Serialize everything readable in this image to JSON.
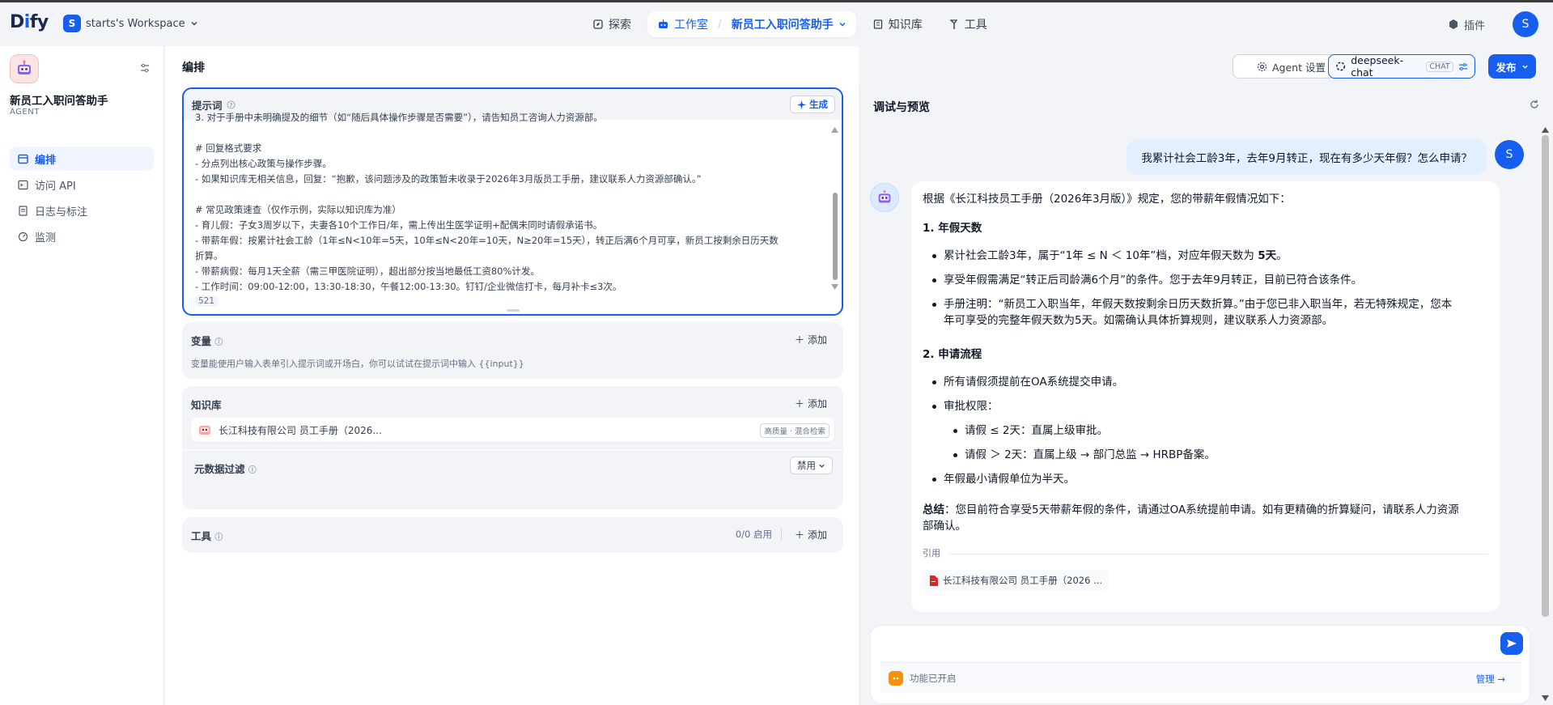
{
  "brand": {
    "logo_a": "D",
    "logo_b": "i",
    "logo_c": "fy"
  },
  "workspace": {
    "initial": "S",
    "name": "starts's Workspace"
  },
  "nav": {
    "explore": "探索",
    "studio": "工作室",
    "app_name": "新员工入职问答助手",
    "knowledge": "知识库",
    "tools": "工具",
    "plugins": "插件",
    "user_initial": "S"
  },
  "sidebar": {
    "app_name": "新员工入职问答助手",
    "app_type": "AGENT",
    "items": [
      {
        "label": "编排",
        "icon": "layout-icon",
        "active": true
      },
      {
        "label": "访问 API",
        "icon": "terminal-icon",
        "active": false
      },
      {
        "label": "日志与标注",
        "icon": "file-text-icon",
        "active": false
      },
      {
        "label": "监测",
        "icon": "monitor-icon",
        "active": false
      }
    ]
  },
  "editor": {
    "title": "编排",
    "agent_settings": "Agent 设置",
    "model_name": "deepseek-chat",
    "model_badge": "CHAT",
    "publish": "发布",
    "prompt": {
      "label": "提示词",
      "generate": "生成",
      "lines": [
        "3. 对于手册中未明确提及的细节（如“随后具体操作步骤是否需要”），请告知员工咨询人力资源部。",
        "",
        "# 回复格式要求",
        "- 分点列出核心政策与操作步骤。",
        "- 如果知识库无相关信息，回复：“抱歉，该问题涉及的政策暂未收录于2026年3月版员工手册，建议联系人力资源部确认。”",
        "",
        "# 常见政策速查（仅作示例，实际以知识库为准）",
        "- 育儿假：子女3周岁以下，夫妻各10个工作日/年，需上传出生医学证明+配偶未同时请假承诺书。",
        "- 带薪年假：按累计社会工龄（1年≤N<10年=5天，10年≤N<20年=10天，N≥20年=15天），转正后满6个月可享，新员工按剩余日历天数",
        "折算。",
        "- 带薪病假：每月1天全薪（需三甲医院证明），超出部分按当地最低工资80%计发。",
        "- 工作时间：09:00-12:00，13:30-18:30，午餐12:00-13:30。钉钉/企业微信打卡，每月补卡≤3次。"
      ],
      "char_count": "521"
    },
    "variables": {
      "label": "变量",
      "add": "添加",
      "hint": "变量能使用户输入表单引入提示词或开场白，你可以试试在提示词中输入 {{input}}"
    },
    "knowledge": {
      "label": "知识库",
      "add": "添加",
      "doc": "长江科技有限公司 员工手册（2026...",
      "tag": "高质量 · 混合检索"
    },
    "metadata": {
      "label": "元数据过滤",
      "value": "禁用"
    },
    "tools": {
      "label": "工具",
      "count": "0/0 启用",
      "add": "添加"
    }
  },
  "debug": {
    "title": "调试与预览",
    "user_initial": "S",
    "user_message": "我累计社会工龄3年，去年9月转正，现在有多少天年假？怎么申请？",
    "answer": {
      "intro": "根据《长江科技员工手册（2026年3月版）》规定，您的带薪年假情况如下：",
      "h1": "1. 年假天数",
      "b1_pre": "累计社会工龄3年，属于“1年 ≤ N ＜ 10年”档，对应年假天数为 ",
      "b1_bold": "5天",
      "b1_post": "。",
      "b2": "享受年假需满足“转正后司龄满6个月”的条件。您于去年9月转正，目前已符合该条件。",
      "b3a": "手册注明：“新员工入职当年，年假天数按剩余日历天数折算。”由于您已非入职当年，若无特殊规定，您本",
      "b3b": "年可享受的完整年假天数为5天。如需确认具体折算规则，建议联系人力资源部。",
      "h2": "2. 申请流程",
      "c1": "所有请假须提前在OA系统提交申请。",
      "c2": "审批权限：",
      "c2a": "请假 ≤ 2天：直属上级审批。",
      "c2b": "请假 ＞ 2天：直属上级 → 部门总监 → HRBP备案。",
      "c3": "年假最小请假单位为半天。",
      "sum_bold": "总结",
      "sum_a": "：您目前符合享受5天带薪年假的条件，请通过OA系统提前申请。如有更精确的折算疑问，请联系人力资源",
      "sum_b": "部确认。",
      "cite_label": "引用",
      "cite_doc": "长江科技有限公司 员工手册（2026 ..."
    },
    "features": "功能已开启",
    "manage": "管理"
  },
  "colors": {
    "accent": "#155eef",
    "bg": "#f2f4f7"
  }
}
